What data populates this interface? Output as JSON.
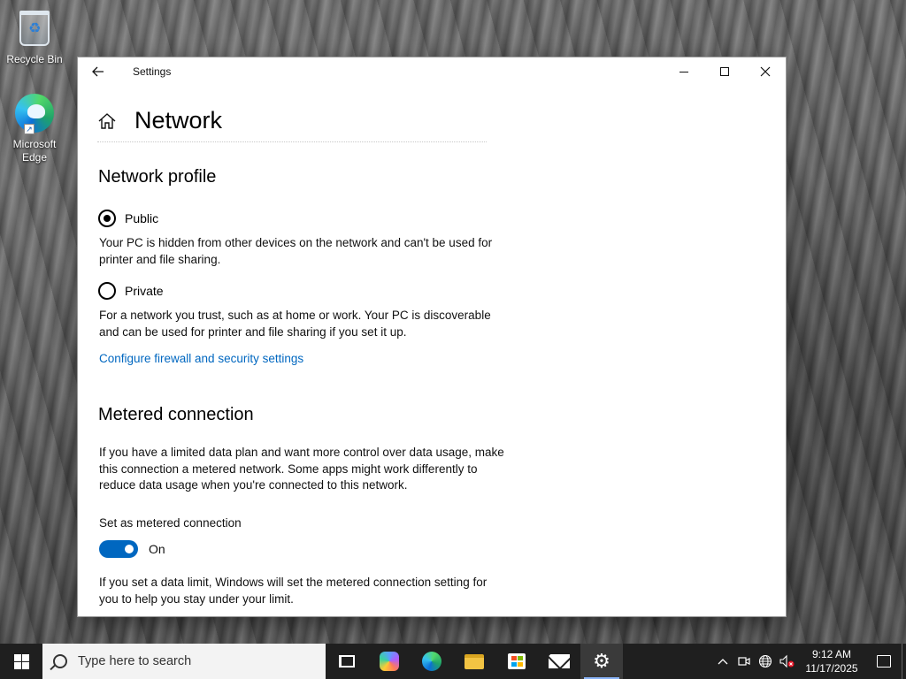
{
  "desktop": {
    "icons": [
      {
        "label": "Recycle Bin",
        "icon": "recycle-bin-icon"
      },
      {
        "label": "Microsoft Edge",
        "icon": "edge-icon"
      }
    ]
  },
  "window": {
    "title": "Settings",
    "page_title": "Network",
    "network_profile": {
      "heading": "Network profile",
      "options": [
        {
          "label": "Public",
          "checked": true,
          "description": "Your PC is hidden from other devices on the network and can't be used for printer and file sharing."
        },
        {
          "label": "Private",
          "checked": false,
          "description": "For a network you trust, such as at home or work. Your PC is discoverable and can be used for printer and file sharing if you set it up."
        }
      ],
      "firewall_link": "Configure firewall and security settings"
    },
    "metered": {
      "heading": "Metered connection",
      "description": "If you have a limited data plan and want more control over data usage, make this connection a metered network. Some apps might work differently to reduce data usage when you're connected to this network.",
      "toggle_label": "Set as metered connection",
      "toggle_state": "On",
      "limit_note": "If you set a data limit, Windows will set the metered connection setting for you to help you stay under your limit."
    }
  },
  "taskbar": {
    "search_placeholder": "Type here to search",
    "apps": [
      "task-view-icon",
      "copilot-icon",
      "edge-icon",
      "file-explorer-icon",
      "microsoft-store-icon",
      "mail-icon",
      "settings-icon"
    ],
    "active_app": "settings-icon",
    "clock": {
      "time": "9:12 AM",
      "date": "11/17/2025"
    }
  },
  "colors": {
    "accent": "#0067c0",
    "taskbar": "#1f1f1f"
  }
}
